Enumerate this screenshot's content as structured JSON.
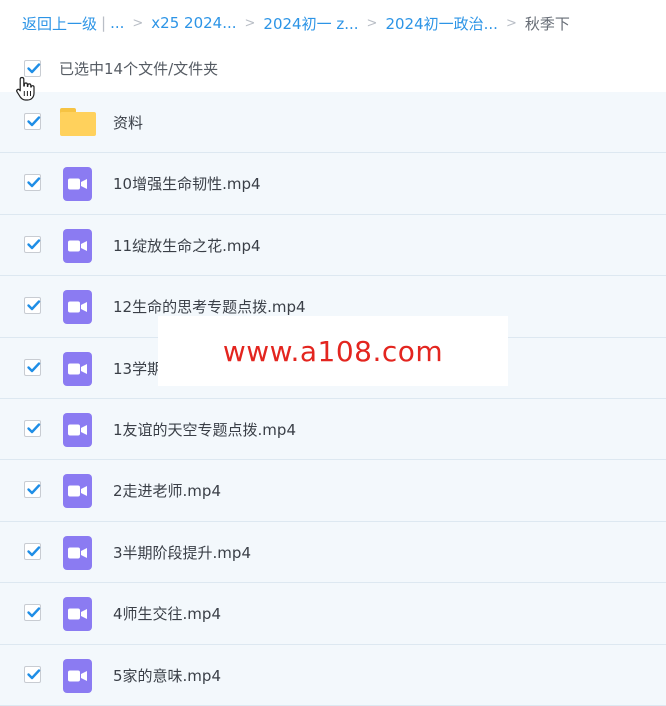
{
  "breadcrumb": {
    "back": "返回上一级",
    "divider": "|",
    "ellipsis": "...",
    "separator": ">",
    "crumbs": [
      "x25 2024...",
      "2024初一 z...",
      "2024初一政治..."
    ],
    "current": "秋季下"
  },
  "selection": {
    "checked": true,
    "text": "已选中14个文件/文件夹"
  },
  "files": [
    {
      "name": "资料",
      "type": "folder",
      "checked": true
    },
    {
      "name": "10增强生命韧性.mp4",
      "type": "video",
      "checked": true
    },
    {
      "name": "11绽放生命之花.mp4",
      "type": "video",
      "checked": true
    },
    {
      "name": "12生命的思考专题点拨.mp4",
      "type": "video",
      "checked": true
    },
    {
      "name": "13学期",
      "type": "video",
      "checked": true
    },
    {
      "name": "1友谊的天空专题点拨.mp4",
      "type": "video",
      "checked": true
    },
    {
      "name": "2走进老师.mp4",
      "type": "video",
      "checked": true
    },
    {
      "name": "3半期阶段提升.mp4",
      "type": "video",
      "checked": true
    },
    {
      "name": "4师生交往.mp4",
      "type": "video",
      "checked": true
    },
    {
      "name": "5家的意味.mp4",
      "type": "video",
      "checked": true
    }
  ],
  "watermark": "www.a108.com",
  "colors": {
    "link": "#2c94e6",
    "check": "#1f8ee6",
    "row_bg": "#f3f8fc",
    "video_icon": "#8b7bf2",
    "folder_icon": "#ffd15c",
    "watermark": "#e3251f"
  }
}
